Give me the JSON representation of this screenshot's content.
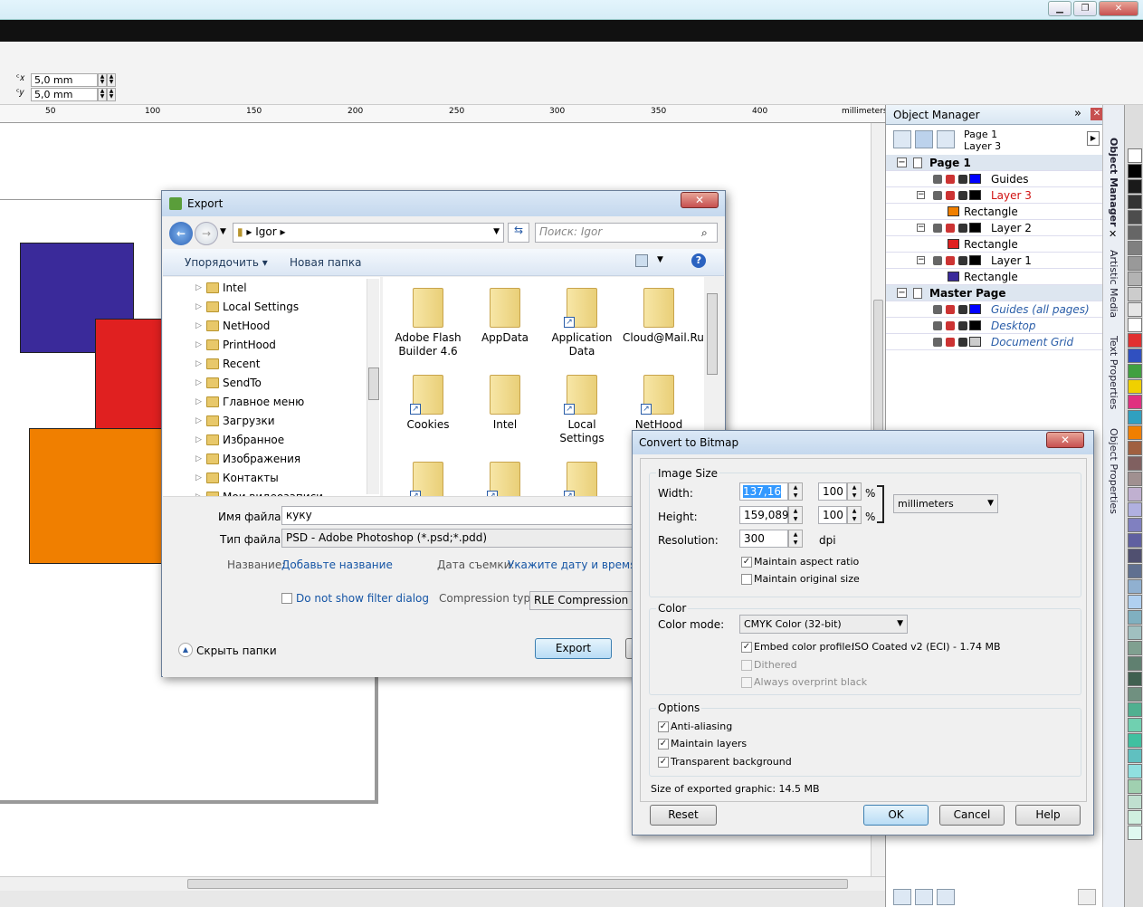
{
  "propbar": {
    "x_value": "5,0 mm",
    "y_value": "5,0 mm"
  },
  "ruler": {
    "ticks": [
      "50",
      "100",
      "150",
      "200",
      "250",
      "300",
      "350",
      "400"
    ],
    "unit": "millimeters"
  },
  "object_manager": {
    "title": "Object Manager",
    "page_info": {
      "page": "Page 1",
      "layer": "Layer 3"
    },
    "rows": [
      {
        "label": "Page 1",
        "kind": "page",
        "bold": true
      },
      {
        "label": "Guides",
        "kind": "layer",
        "color": "#0000ff"
      },
      {
        "label": "Layer 3",
        "kind": "layer-active",
        "color": "#000000"
      },
      {
        "label": "Rectangle",
        "kind": "object",
        "color": "#f07f00"
      },
      {
        "label": "Layer 2",
        "kind": "layer",
        "color": "#000000"
      },
      {
        "label": "Rectangle",
        "kind": "object",
        "color": "#e02020"
      },
      {
        "label": "Layer 1",
        "kind": "layer",
        "color": "#000000"
      },
      {
        "label": "Rectangle",
        "kind": "object",
        "color": "#3a2a9a"
      },
      {
        "label": "Master Page",
        "kind": "page",
        "bold": true
      },
      {
        "label": "Guides (all pages)",
        "kind": "master",
        "color": "#0000ff"
      },
      {
        "label": "Desktop",
        "kind": "master",
        "color": "#000000"
      },
      {
        "label": "Document Grid",
        "kind": "master",
        "color": "#cccccc"
      }
    ]
  },
  "dock_tabs": [
    "Object Manager",
    "Artistic Media",
    "Text Properties",
    "Object Properties"
  ],
  "palette": [
    "#ffffff",
    "#000000",
    "#1a1a1a",
    "#333333",
    "#4d4d4d",
    "#666666",
    "#808080",
    "#999999",
    "#b3b3b3",
    "#cccccc",
    "#e6e6e6",
    "#ffffff",
    "#e03030",
    "#3050c0",
    "#40a040",
    "#f0d000",
    "#e03080",
    "#30a0c0",
    "#f07f00",
    "#a06040",
    "#806060",
    "#a09090",
    "#c0b0d0",
    "#b0b0e0",
    "#8080c0",
    "#6060a0",
    "#505070",
    "#607090",
    "#90b0d0",
    "#b0d0f0",
    "#80b0c0",
    "#a0c0c0",
    "#80a090",
    "#608070",
    "#406050",
    "#709080",
    "#50b090",
    "#70d0b0",
    "#40c0a0",
    "#60c0c0",
    "#90e0e0",
    "#a0d0b0",
    "#c0e0d0",
    "#d0f0e0",
    "#e0f8f0"
  ],
  "export": {
    "title": "Export",
    "path": "Igor",
    "search_placeholder": "Поиск: Igor",
    "organize": "Упорядочить",
    "new_folder": "Новая папка",
    "tree": [
      "Intel",
      "Local Settings",
      "NetHood",
      "PrintHood",
      "Recent",
      "SendTo",
      "Главное меню",
      "Загрузки",
      "Избранное",
      "Изображения",
      "Контакты",
      "Мои видеозаписи"
    ],
    "files": [
      {
        "name": "Adobe Flash Builder 4.6",
        "shortcut": false
      },
      {
        "name": "AppData",
        "shortcut": false
      },
      {
        "name": "Application Data",
        "shortcut": true
      },
      {
        "name": "Cloud@Mail.Ru",
        "shortcut": false
      },
      {
        "name": "Cookies",
        "shortcut": true
      },
      {
        "name": "Intel",
        "shortcut": false
      },
      {
        "name": "Local Settings",
        "shortcut": true
      },
      {
        "name": "NetHood",
        "shortcut": true
      },
      {
        "name": "",
        "shortcut": true
      },
      {
        "name": "",
        "shortcut": true
      },
      {
        "name": "",
        "shortcut": true
      }
    ],
    "filename_label": "Имя файла:",
    "filename_value": "куку",
    "filetype_label": "Тип файла:",
    "filetype_value": "PSD - Adobe Photoshop (*.psd;*.pdd)",
    "name_label": "Название:",
    "name_link": "Добавьте название",
    "date_label": "Дата съемки:",
    "date_link": "Укажите дату и время",
    "no_filter": "Do not show filter dialog",
    "compression_label": "Compression type",
    "compression_value": "RLE Compression",
    "hide_folders": "Скрыть папки",
    "export_button": "Export"
  },
  "bitmap": {
    "title": "Convert to Bitmap",
    "image_size": "Image Size",
    "width_label": "Width:",
    "width_value": "137,16",
    "width_pct": "100",
    "height_label": "Height:",
    "height_value": "159,089",
    "height_pct": "100",
    "pct": "%",
    "units": "millimeters",
    "resolution_label": "Resolution:",
    "resolution_value": "300",
    "dpi": "dpi",
    "maintain_aspect": "Maintain aspect ratio",
    "maintain_original": "Maintain original size",
    "color": "Color",
    "color_mode_label": "Color mode:",
    "color_mode_value": "CMYK Color (32-bit)",
    "embed_profile": "Embed color profile:",
    "profile_value": "ISO Coated v2 (ECI) - 1.74 MB",
    "dithered": "Dithered",
    "overprint": "Always overprint black",
    "options": "Options",
    "anti_alias": "Anti-aliasing",
    "maintain_layers": "Maintain layers",
    "transparent_bg": "Transparent background",
    "size_text": "Size of exported graphic: 14.5 MB",
    "reset": "Reset",
    "ok": "OK",
    "cancel": "Cancel",
    "help": "Help"
  },
  "canvas_shapes": [
    {
      "name": "blue-rectangle",
      "color": "#3a2a9a"
    },
    {
      "name": "red-rectangle",
      "color": "#e02020"
    },
    {
      "name": "orange-rectangle",
      "color": "#f07f00"
    }
  ]
}
